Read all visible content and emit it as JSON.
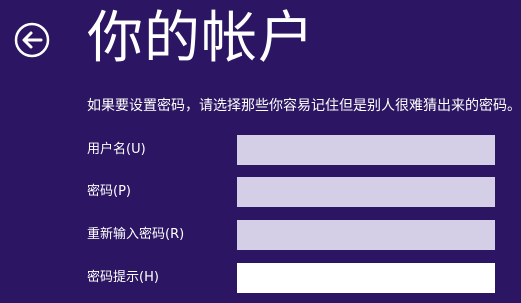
{
  "page": {
    "title": "你的帐户",
    "back_icon": "back-arrow-icon",
    "instruction": "如果要设置密码，请选择那些你容易记住但是别人很难猜出来的密码。"
  },
  "form": {
    "username": {
      "label": "用户名(U)",
      "value": ""
    },
    "password": {
      "label": "密码(P)",
      "value": ""
    },
    "reenter_password": {
      "label": "重新输入密码(R)",
      "value": ""
    },
    "password_hint": {
      "label": "密码提示(H)",
      "value": ""
    }
  },
  "colors": {
    "background": "#2c1663",
    "field_inactive": "#d4cfe6",
    "field_active": "#ffffff",
    "text": "#ffffff"
  }
}
